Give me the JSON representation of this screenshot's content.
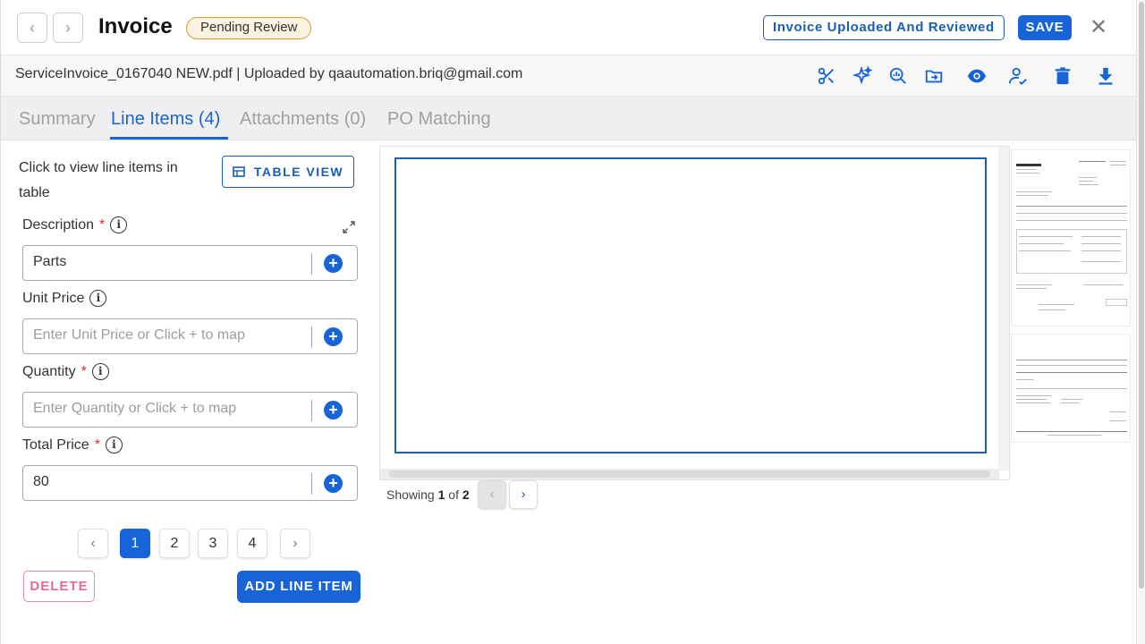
{
  "header": {
    "title": "Invoice",
    "status_badge": "Pending Review",
    "reviewed_button": "Invoice Uploaded And Reviewed",
    "save_button": "SAVE"
  },
  "file": {
    "name_line": "ServiceInvoice_0167040 NEW.pdf | Uploaded by qaautomation.briq@gmail.com"
  },
  "toolbar_icons": [
    "scissors-icon",
    "sparkle-icon",
    "zoom-chart-icon",
    "folder-move-icon",
    "eye-icon",
    "user-check-icon",
    "trash-icon",
    "download-icon"
  ],
  "tabs": [
    {
      "label": "Summary"
    },
    {
      "label": "Line Items (4)"
    },
    {
      "label": "Attachments (0)"
    },
    {
      "label": "PO Matching"
    }
  ],
  "left": {
    "hint": "Click to view line items in table",
    "table_view_button": "TABLE VIEW",
    "fields": {
      "description": {
        "label": "Description",
        "value": "Parts",
        "placeholder": ""
      },
      "unit_price": {
        "label": "Unit Price",
        "value": "",
        "placeholder": "Enter Unit Price or Click + to map"
      },
      "quantity": {
        "label": "Quantity",
        "value": "",
        "placeholder": "Enter Quantity or Click + to map"
      },
      "total_price": {
        "label": "Total Price",
        "value": "80",
        "placeholder": ""
      }
    },
    "required_mark": "*",
    "pagination": {
      "pages": [
        "1",
        "2",
        "3",
        "4"
      ],
      "current": "1"
    },
    "delete_button": "DELETE",
    "add_line_button": "ADD LINE ITEM"
  },
  "viewer": {
    "showing_prefix": "Showing",
    "current_page": "1",
    "of_word": "of",
    "total_pages": "2"
  },
  "colors": {
    "accent": "#1664d8",
    "status_border": "#d79a3a",
    "delete": "#e56a98"
  }
}
